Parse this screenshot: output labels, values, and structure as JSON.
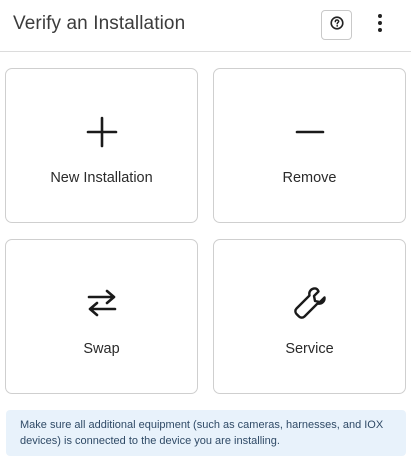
{
  "header": {
    "title": "Verify an Installation",
    "help_icon": "question-circle-icon",
    "more_icon": "vertical-dots-icon"
  },
  "cards": [
    {
      "label": "New Installation",
      "icon": "plus-icon"
    },
    {
      "label": "Remove",
      "icon": "minus-icon"
    },
    {
      "label": "Swap",
      "icon": "swap-arrows-icon"
    },
    {
      "label": "Service",
      "icon": "wrench-icon"
    }
  ],
  "notice": {
    "text": "Make sure all additional equipment (such as cameras, harnesses, and IOX devices) is connected to the device you are installing."
  },
  "colors": {
    "notice_bg": "#e8f2fb",
    "notice_text": "#2f4a66",
    "card_border": "#cfcfcf"
  }
}
